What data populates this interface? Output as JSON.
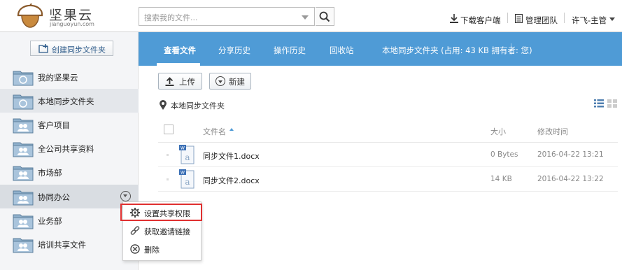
{
  "app": {
    "logo_text": "坚果云",
    "logo_sub": "jianguoyun.com"
  },
  "search": {
    "placeholder": "搜索我的文件..."
  },
  "top_links": {
    "download": "下载客户端",
    "manage_team": "管理团队",
    "user": "许飞-主管"
  },
  "sidebar": {
    "create_label": "创建同步文件夹",
    "items": [
      {
        "label": "我的坚果云"
      },
      {
        "label": "本地同步文件夹"
      },
      {
        "label": "客户项目"
      },
      {
        "label": "全公司共享资料"
      },
      {
        "label": "市场部"
      },
      {
        "label": "协同办公"
      },
      {
        "label": "业务部"
      },
      {
        "label": "培训共享文件"
      }
    ]
  },
  "context_menu": {
    "items": [
      {
        "label": "设置共享权限"
      },
      {
        "label": "获取邀请链接"
      },
      {
        "label": "删除"
      }
    ]
  },
  "tabs": {
    "items": [
      {
        "label": "查看文件"
      },
      {
        "label": "分享历史"
      },
      {
        "label": "操作历史"
      },
      {
        "label": "回收站"
      }
    ],
    "info": "本地同步文件夹 (占用:  43 KB   拥有者:  您)"
  },
  "toolbar": {
    "upload_label": "上传",
    "new_label": "新建"
  },
  "path": {
    "current": "本地同步文件夹"
  },
  "table": {
    "headers": {
      "name": "文件名",
      "size": "大小",
      "mtime": "修改时间"
    },
    "rows": [
      {
        "name": "同步文件1.docx",
        "size": "0 Bytes",
        "mtime": "2016-04-22 13:21"
      },
      {
        "name": "同步文件2.docx",
        "size": "14 KB",
        "mtime": "2016-04-22 13:22"
      }
    ]
  },
  "colors": {
    "accent": "#4f9bd6",
    "highlight": "#e03030"
  }
}
